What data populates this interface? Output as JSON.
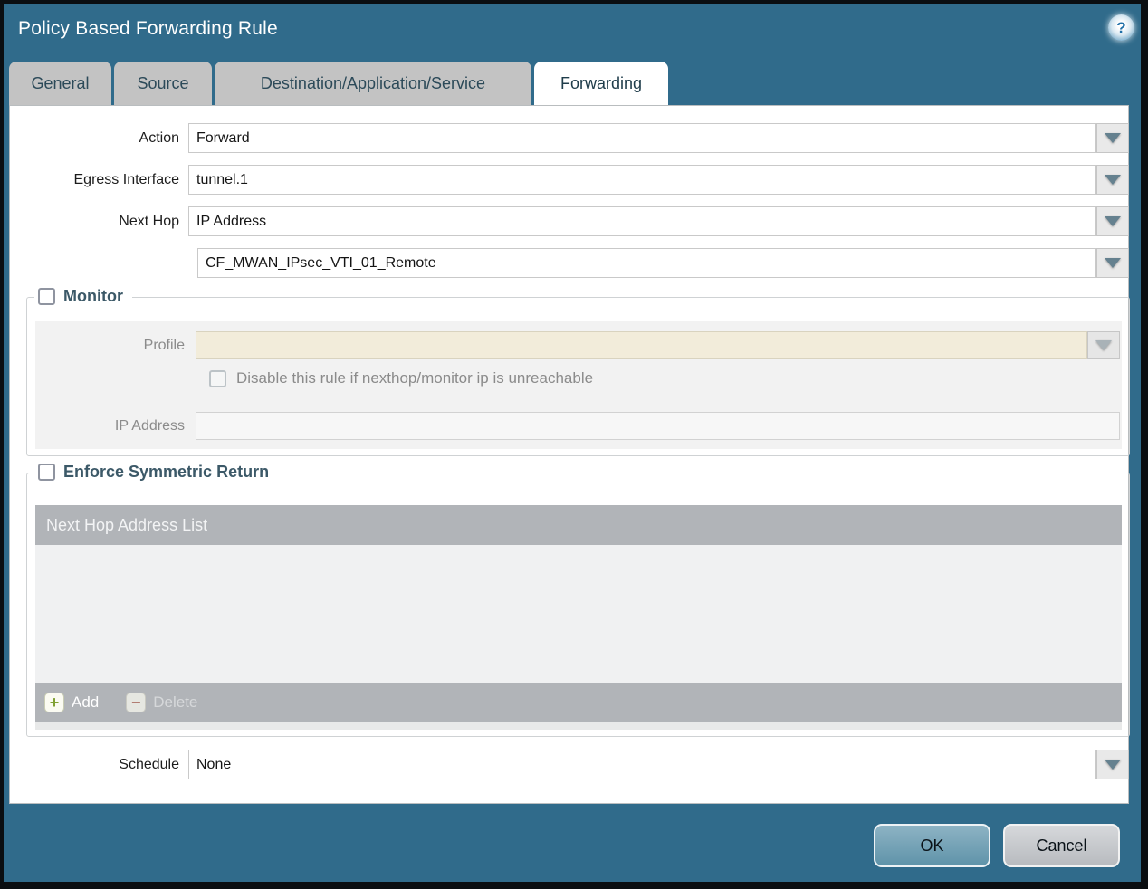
{
  "window": {
    "title": "Policy Based Forwarding Rule",
    "help_glyph": "?"
  },
  "tabs": [
    {
      "label": "General",
      "active": false
    },
    {
      "label": "Source",
      "active": false
    },
    {
      "label": "Destination/Application/Service",
      "active": false
    },
    {
      "label": "Forwarding",
      "active": true
    }
  ],
  "form": {
    "action": {
      "label": "Action",
      "value": "Forward"
    },
    "egress_interface": {
      "label": "Egress Interface",
      "value": "tunnel.1"
    },
    "next_hop": {
      "label": "Next Hop",
      "value": "IP Address"
    },
    "next_hop_address": {
      "value": "CF_MWAN_IPsec_VTI_01_Remote"
    },
    "schedule": {
      "label": "Schedule",
      "value": "None"
    }
  },
  "monitor": {
    "legend": "Monitor",
    "checked": false,
    "profile": {
      "label": "Profile",
      "value": ""
    },
    "disable_rule_label": "Disable this rule if nexthop/monitor ip is unreachable",
    "disable_rule_checked": false,
    "ip_address": {
      "label": "IP Address",
      "value": ""
    }
  },
  "symmetric_return": {
    "legend": "Enforce Symmetric Return",
    "checked": false,
    "table_header": "Next Hop Address List",
    "rows": [],
    "add_label": "Add",
    "delete_label": "Delete",
    "plus_glyph": "+",
    "minus_glyph": "−"
  },
  "footer": {
    "ok_label": "OK",
    "cancel_label": "Cancel"
  },
  "colors": {
    "frame_teal": "#306b8b",
    "tab_inactive": "#c3c3c3",
    "tab_text": "#2c4a59",
    "table_gray": "#b1b4b8",
    "panel_gray": "#f2f2f2",
    "disabled_cream": "#f2ecda",
    "ok_button": "#6f9fb5",
    "cancel_button": "#c6c9cc",
    "legend_text": "#3c5968"
  }
}
